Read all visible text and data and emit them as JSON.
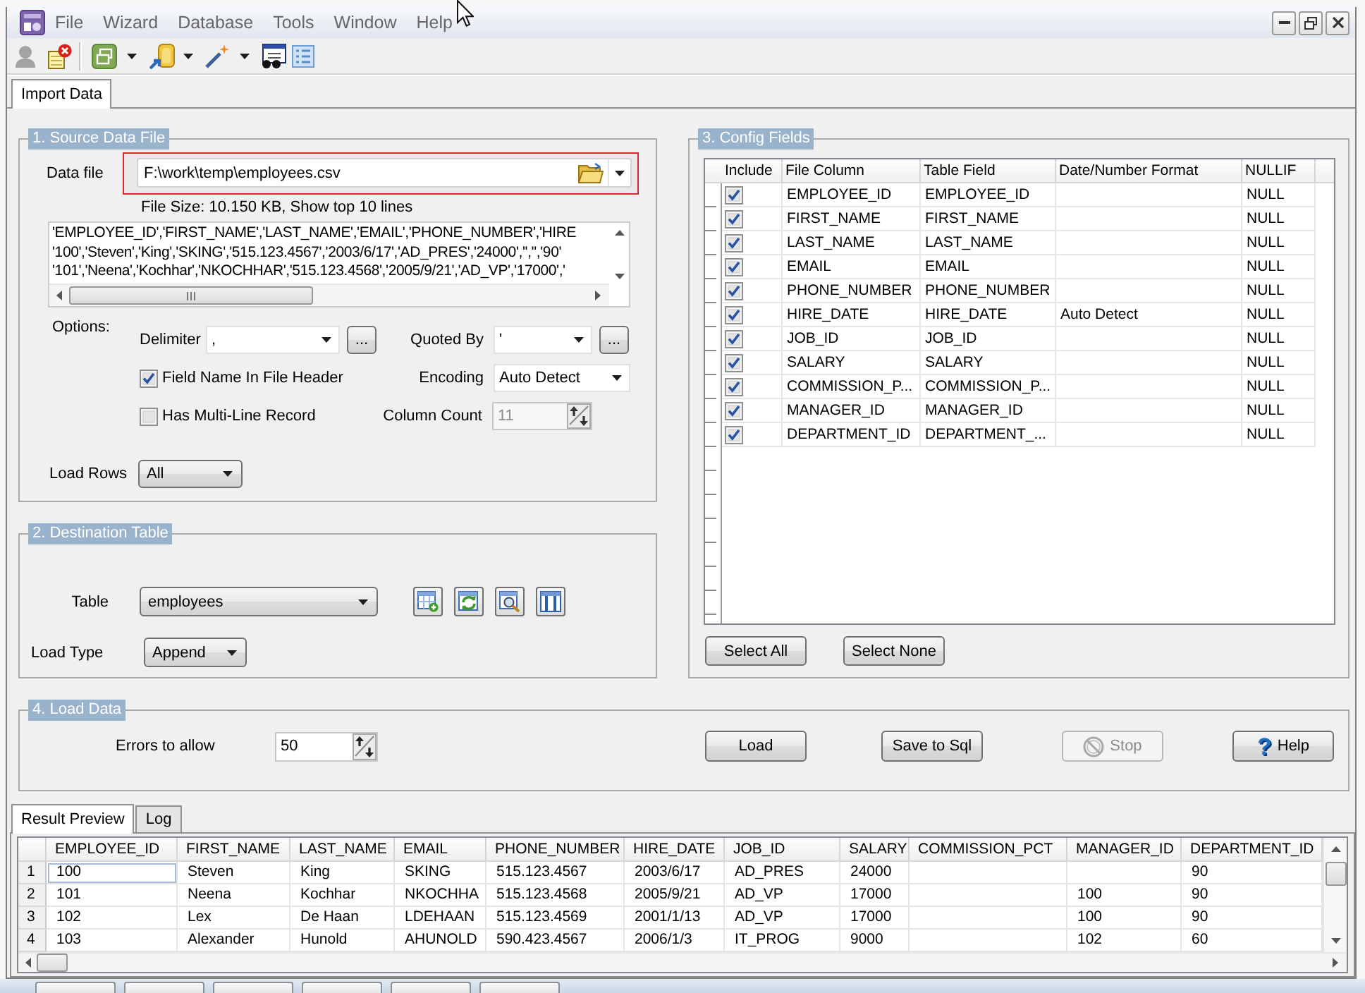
{
  "window": {
    "menu": [
      "File",
      "Wizard",
      "Database",
      "Tools",
      "Window",
      "Help"
    ]
  },
  "tabs": [
    {
      "label": "Import Data",
      "selected": true
    }
  ],
  "source": {
    "title": "1. Source Data File",
    "data_file": {
      "label": "Data file",
      "value": "F:\\work\\temp\\employees.csv",
      "highlighted": true
    },
    "file_info": "File Size: 10.150 KB, Show top 10 lines",
    "preview_lines": [
      "'EMPLOYEE_ID','FIRST_NAME','LAST_NAME','EMAIL','PHONE_NUMBER','HIRE",
      "'100','Steven','King','SKING','515.123.4567','2003/6/17','AD_PRES','24000','','','90'",
      "'101','Neena','Kochhar','NKOCHHAR','515.123.4568','2005/9/21','AD_VP','17000','"
    ],
    "options_label": "Options:",
    "delimiter": {
      "label": "Delimiter",
      "value": ",",
      "button": "..."
    },
    "quoted_by": {
      "label": "Quoted By",
      "value": "'",
      "button": "..."
    },
    "field_name_in_header": {
      "label": "Field Name In File Header",
      "checked": true
    },
    "encoding": {
      "label": "Encoding",
      "value": "Auto Detect"
    },
    "multi_line_record": {
      "label": "Has Multi-Line Record",
      "checked": false
    },
    "column_count": {
      "label": "Column Count",
      "value": "11",
      "disabled": true
    },
    "load_rows": {
      "label": "Load Rows",
      "value": "All"
    }
  },
  "destination": {
    "title": "2. Destination Table",
    "table": {
      "label": "Table",
      "value": "employees"
    },
    "load_type": {
      "label": "Load Type",
      "value": "Append"
    }
  },
  "config": {
    "title": "3. Config Fields",
    "columns": [
      "Include",
      "File Column",
      "Table Field",
      "Date/Number Format",
      "NULLIF"
    ],
    "rows": [
      {
        "include": true,
        "file_column": "EMPLOYEE_ID",
        "table_field": "EMPLOYEE_ID",
        "nullif": "NULL"
      },
      {
        "include": true,
        "file_column": "FIRST_NAME",
        "table_field": "FIRST_NAME",
        "nullif": "NULL"
      },
      {
        "include": true,
        "file_column": "LAST_NAME",
        "table_field": "LAST_NAME",
        "nullif": "NULL"
      },
      {
        "include": true,
        "file_column": "EMAIL",
        "table_field": "EMAIL",
        "nullif": "NULL"
      },
      {
        "include": true,
        "file_column": "PHONE_NUMBER",
        "table_field": "PHONE_NUMBER",
        "nullif": "NULL"
      },
      {
        "include": true,
        "file_column": "HIRE_DATE",
        "table_field": "HIRE_DATE",
        "format": "Auto Detect",
        "nullif": "NULL"
      },
      {
        "include": true,
        "file_column": "JOB_ID",
        "table_field": "JOB_ID",
        "nullif": "NULL"
      },
      {
        "include": true,
        "file_column": "SALARY",
        "table_field": "SALARY",
        "nullif": "NULL"
      },
      {
        "include": true,
        "file_column": "COMMISSION_P...",
        "table_field": "COMMISSION_P...",
        "nullif": "NULL"
      },
      {
        "include": true,
        "file_column": "MANAGER_ID",
        "table_field": "MANAGER_ID",
        "nullif": "NULL"
      },
      {
        "include": true,
        "file_column": "DEPARTMENT_ID",
        "table_field": "DEPARTMENT_...",
        "nullif": "NULL"
      }
    ],
    "buttons": [
      "Select All",
      "Select None"
    ]
  },
  "load": {
    "title": "4. Load Data",
    "errors": {
      "label": "Errors to allow",
      "value": "50"
    },
    "buttons": [
      {
        "kind": "plain",
        "label": "Load",
        "disabled": false
      },
      {
        "kind": "plain",
        "label": "Save to Sql",
        "disabled": false
      },
      {
        "kind": "stop",
        "label": "Stop",
        "disabled": true
      },
      {
        "kind": "help",
        "label": "Help",
        "icon": "?",
        "disabled": false
      }
    ]
  },
  "result_tabs": [
    {
      "label": "Result Preview",
      "selected": true
    },
    {
      "label": "Log",
      "selected": false
    }
  ],
  "result": {
    "columns": [
      "EMPLOYEE_ID",
      "FIRST_NAME",
      "LAST_NAME",
      "EMAIL",
      "PHONE_NUMBER",
      "HIRE_DATE",
      "JOB_ID",
      "SALARY",
      "COMMISSION_PCT",
      "MANAGER_ID",
      "DEPARTMENT_ID"
    ],
    "rows": [
      {
        "number": "1",
        "selected": true,
        "cells": [
          "100",
          "Steven",
          "King",
          "SKING",
          "515.123.4567",
          "2003/6/17",
          "AD_PRES",
          "24000",
          null,
          null,
          "90"
        ]
      },
      {
        "number": "2",
        "selected": false,
        "cells": [
          "101",
          "Neena",
          "Kochhar",
          "NKOCHHA",
          "515.123.4568",
          "2005/9/21",
          "AD_VP",
          "17000",
          null,
          "100",
          "90"
        ]
      },
      {
        "number": "3",
        "selected": false,
        "cells": [
          "102",
          "Lex",
          "De Haan",
          "LDEHAAN",
          "515.123.4569",
          "2001/1/13",
          "AD_VP",
          "17000",
          null,
          "100",
          "90"
        ]
      },
      {
        "number": "4",
        "selected": false,
        "cells": [
          "103",
          "Alexander",
          "Hunold",
          "AHUNOLD",
          "590.423.4567",
          "2006/1/3",
          "IT_PROG",
          "9000",
          null,
          "102",
          "60"
        ]
      }
    ]
  }
}
